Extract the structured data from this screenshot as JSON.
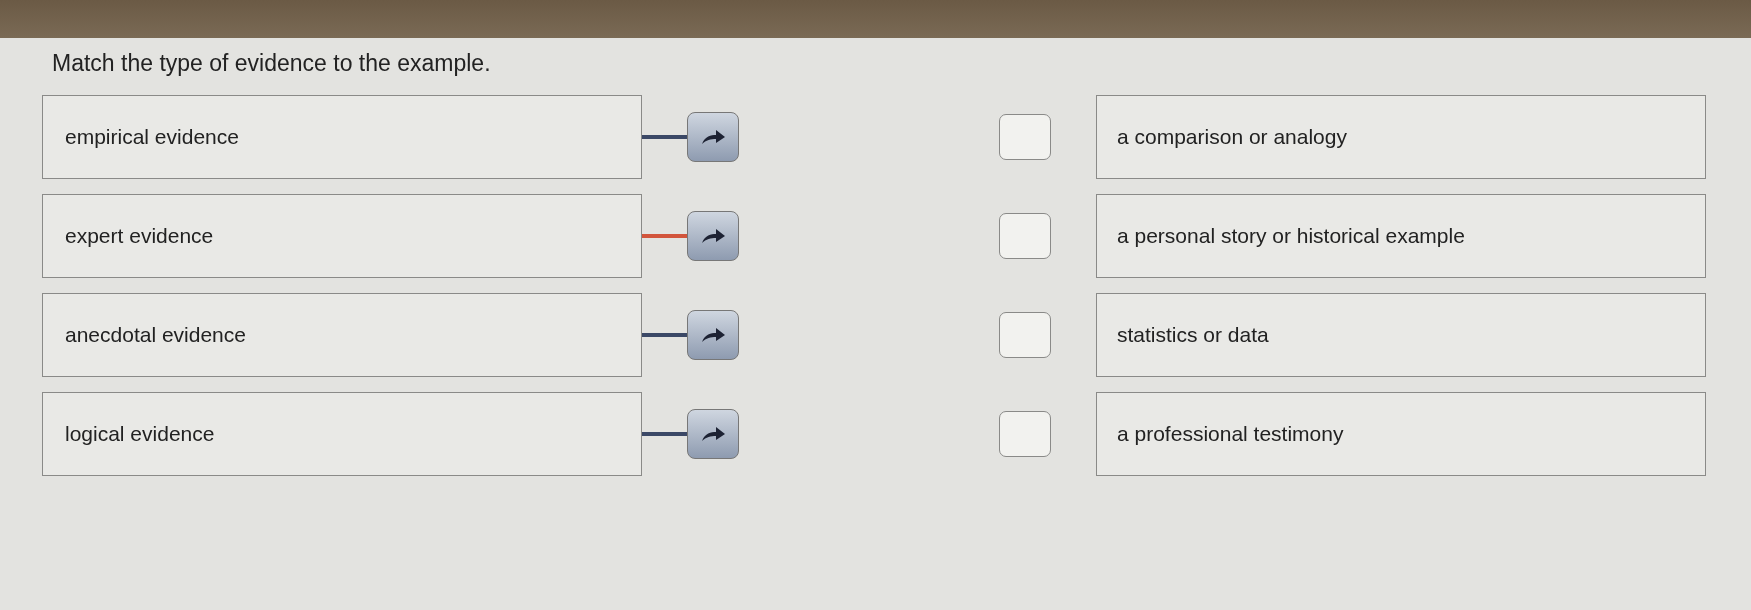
{
  "title": "Match the type of evidence to the example.",
  "terms": [
    {
      "text": "empirical evidence",
      "color": "#3b4866"
    },
    {
      "text": "expert evidence",
      "color": "#d2553c"
    },
    {
      "text": "anecdotal evidence",
      "color": "#3b4866"
    },
    {
      "text": "logical evidence",
      "color": "#3b4866"
    }
  ],
  "options": [
    {
      "text": "a comparison or analogy",
      "checked": false
    },
    {
      "text": "a personal story or historical example",
      "checked": false
    },
    {
      "text": "statistics or data",
      "checked": false
    },
    {
      "text": "a professional testimony",
      "checked": false
    }
  ]
}
